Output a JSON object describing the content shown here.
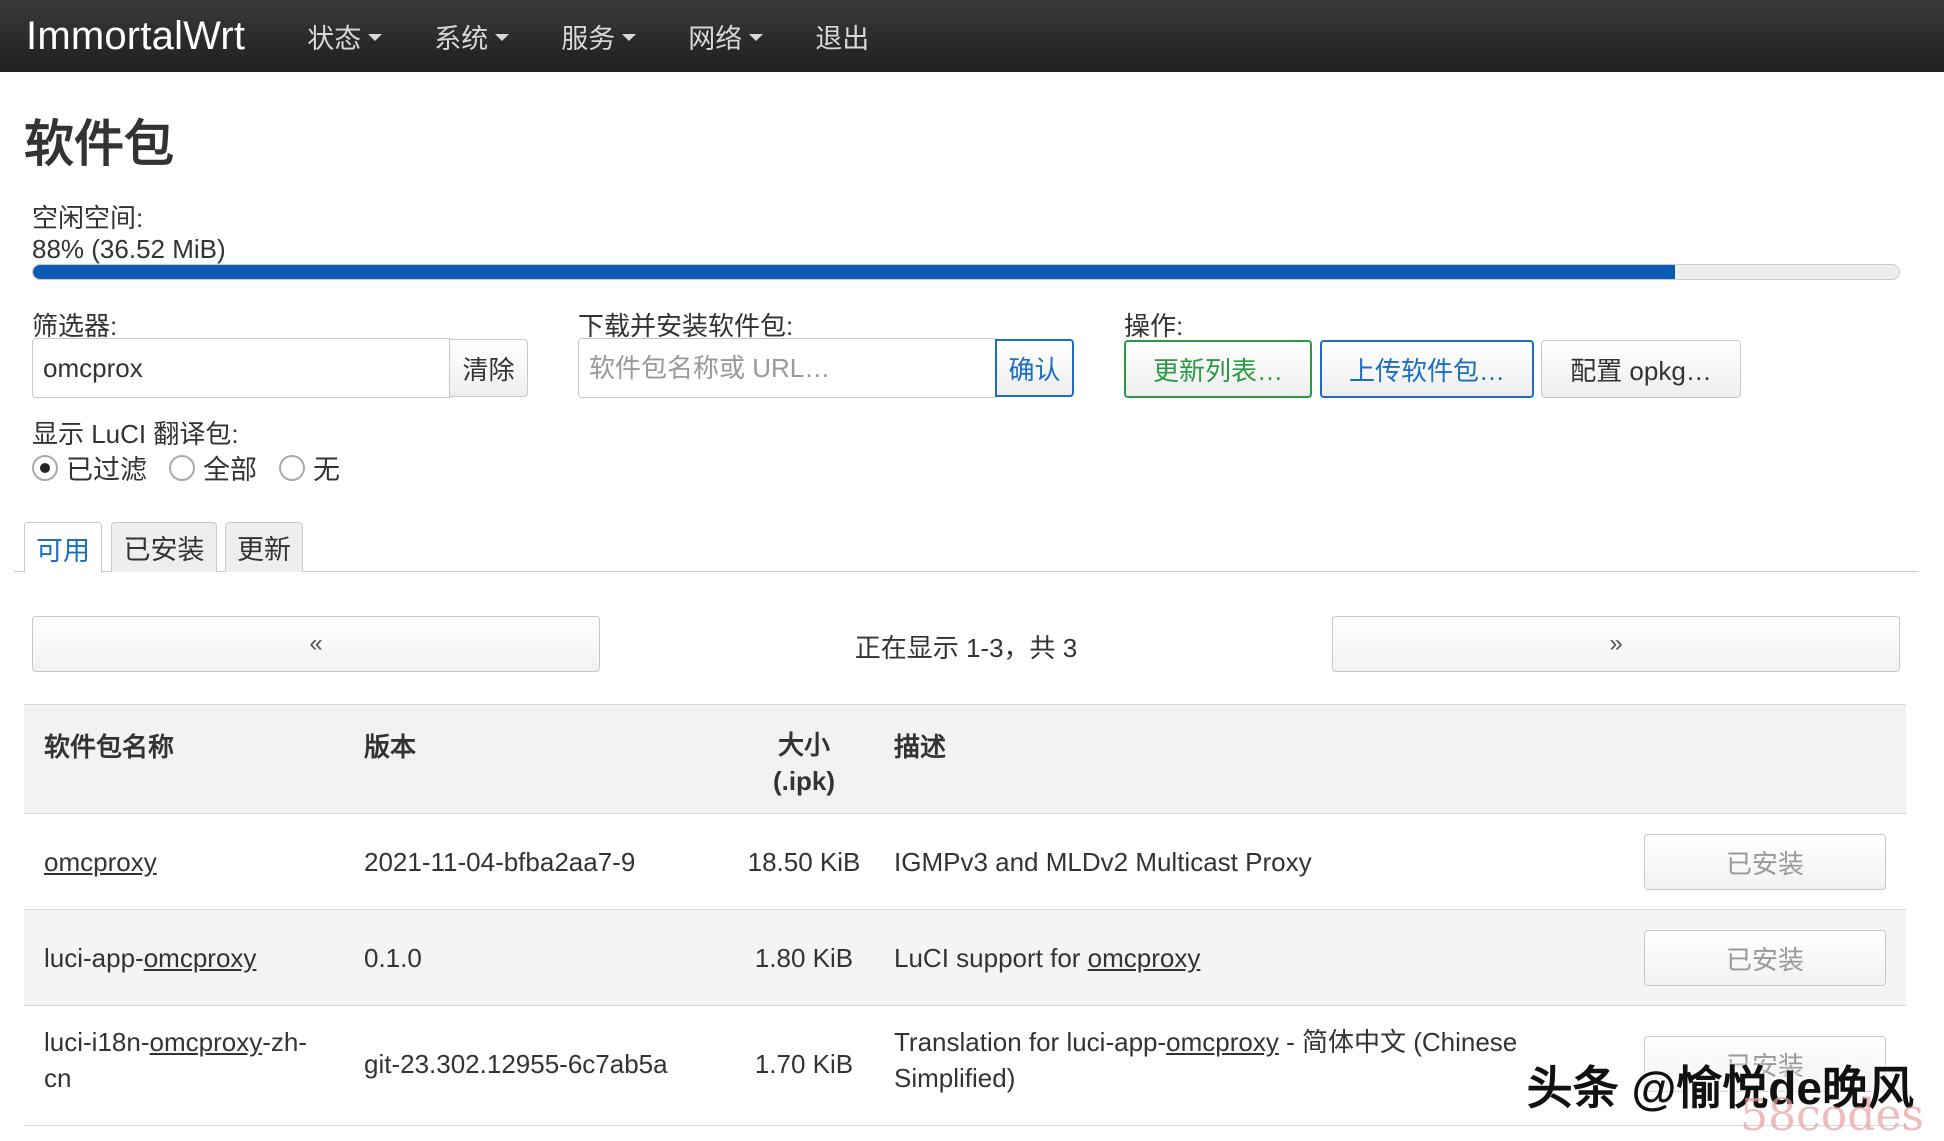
{
  "navbar": {
    "brand": "ImmortalWrt",
    "menu": [
      {
        "label": "状态",
        "dropdown": true
      },
      {
        "label": "系统",
        "dropdown": true
      },
      {
        "label": "服务",
        "dropdown": true
      },
      {
        "label": "网络",
        "dropdown": true
      },
      {
        "label": "退出",
        "dropdown": false
      }
    ]
  },
  "page": {
    "title": "软件包",
    "free_space_label": "空闲空间:",
    "free_space_value": "88% (36.52 MiB)",
    "free_space_fraction": 0.88
  },
  "filter": {
    "label": "筛选器:",
    "value": "omcprox",
    "clear_label": "清除"
  },
  "download": {
    "label": "下载并安装软件包:",
    "placeholder": "软件包名称或 URL…",
    "confirm_label": "确认"
  },
  "actions": {
    "label": "操作:",
    "update_label": "更新列表…",
    "upload_label": "上传软件包…",
    "configure_label": "配置 opkg…"
  },
  "translation": {
    "label": "显示 LuCI 翻译包:",
    "options": [
      {
        "label": "已过滤",
        "checked": true
      },
      {
        "label": "全部",
        "checked": false
      },
      {
        "label": "无",
        "checked": false
      }
    ]
  },
  "tabs": [
    {
      "label": "可用",
      "active": true
    },
    {
      "label": "已安装",
      "active": false
    },
    {
      "label": "更新",
      "active": false
    }
  ],
  "pager": {
    "prev_label": "«",
    "next_label": "»",
    "status": "正在显示 1-3，共 3"
  },
  "table": {
    "headers": {
      "name": "软件包名称",
      "version": "版本",
      "size_line1": "大小",
      "size_line2": "(.ipk)",
      "description": "描述"
    },
    "rows": [
      {
        "name_prefix": "",
        "name_link": "omcproxy",
        "name_suffix": "",
        "version": "2021-11-04-bfba2aa7-9",
        "size": "18.50 KiB",
        "desc_prefix": "IGMPv3 and MLDv2 Multicast Proxy",
        "desc_link": "",
        "desc_suffix": "",
        "desc_line2": "",
        "action": "已安装"
      },
      {
        "name_prefix": "luci-app-",
        "name_link": "omcproxy",
        "name_suffix": "",
        "version": "0.1.0",
        "size": "1.80 KiB",
        "desc_prefix": "LuCI support for ",
        "desc_link": "omcproxy",
        "desc_suffix": "",
        "desc_line2": "",
        "action": "已安装"
      },
      {
        "name_prefix": "luci-i18n-",
        "name_link": "omcproxy",
        "name_suffix": "-zh-",
        "name_line2": "cn",
        "version": "git-23.302.12955-6c7ab5a",
        "size": "1.70 KiB",
        "desc_prefix": "Translation for luci-app-",
        "desc_link": "omcproxy",
        "desc_suffix": " - 简体中文 (Chinese",
        "desc_line2": "Simplified)",
        "action": "已安装"
      }
    ]
  },
  "watermark": {
    "text": "头条 @愉悦de晚风",
    "text2": "58codes"
  },
  "colors": {
    "navbar_bg": "#2b2b2b",
    "progress": "#0d5bb8",
    "primary": "#1b6ec2",
    "success": "#2a9a45"
  }
}
